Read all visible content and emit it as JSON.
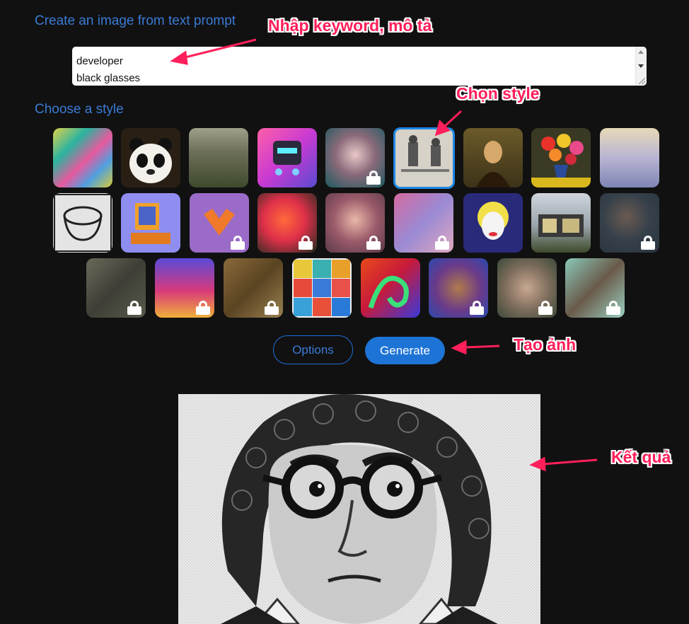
{
  "prompt": {
    "heading": "Create an image from text prompt",
    "lines": [
      "developer",
      "black glasses"
    ]
  },
  "style": {
    "heading": "Choose a style",
    "tiles": [
      {
        "name": "style-abstract-paint",
        "locked": false,
        "selected": false
      },
      {
        "name": "style-panda",
        "locked": false,
        "selected": false
      },
      {
        "name": "style-forest-landscape",
        "locked": false,
        "selected": false
      },
      {
        "name": "style-robot",
        "locked": false,
        "selected": false
      },
      {
        "name": "style-anime-girl",
        "locked": true,
        "selected": false
      },
      {
        "name": "style-engraving",
        "locked": false,
        "selected": true
      },
      {
        "name": "style-mona-lisa",
        "locked": false,
        "selected": false
      },
      {
        "name": "style-flower-vase",
        "locked": false,
        "selected": false
      },
      {
        "name": "style-ballet-dancers",
        "locked": false,
        "selected": false
      },
      {
        "name": "style-sketch-bowl",
        "locked": false,
        "selected": false
      },
      {
        "name": "style-isometric-computer",
        "locked": false,
        "selected": false
      },
      {
        "name": "style-fox",
        "locked": true,
        "selected": false
      },
      {
        "name": "style-neon-face",
        "locked": true,
        "selected": false
      },
      {
        "name": "style-portrait-woman",
        "locked": true,
        "selected": false
      },
      {
        "name": "style-pastel-abstract",
        "locked": true,
        "selected": false
      },
      {
        "name": "style-pop-art-marilyn",
        "locked": false,
        "selected": false
      },
      {
        "name": "style-modern-house",
        "locked": false,
        "selected": false
      },
      {
        "name": "style-cloud",
        "locked": true,
        "selected": false
      },
      {
        "name": "style-ruins",
        "locked": true,
        "selected": false
      },
      {
        "name": "style-rabbit",
        "locked": true,
        "selected": false
      },
      {
        "name": "style-old-painting",
        "locked": true,
        "selected": false
      },
      {
        "name": "style-icon-grid",
        "locked": false,
        "selected": false
      },
      {
        "name": "style-dragon",
        "locked": false,
        "selected": false
      },
      {
        "name": "style-colorful-face",
        "locked": true,
        "selected": false
      },
      {
        "name": "style-fantasy-face",
        "locked": true,
        "selected": false
      },
      {
        "name": "style-teal-tree",
        "locked": true,
        "selected": false
      }
    ]
  },
  "buttons": {
    "options": "Options",
    "generate": "Generate"
  },
  "annotations": {
    "prompt": "Nhập keyword, mô tả",
    "style": "Chọn style",
    "generate": "Tạo ảnh",
    "result": "Kết quả"
  },
  "colors": {
    "background": "#111111",
    "heading": "#3a7bd5",
    "accent": "#1e74d6",
    "annotation": "#ff1f5a"
  }
}
